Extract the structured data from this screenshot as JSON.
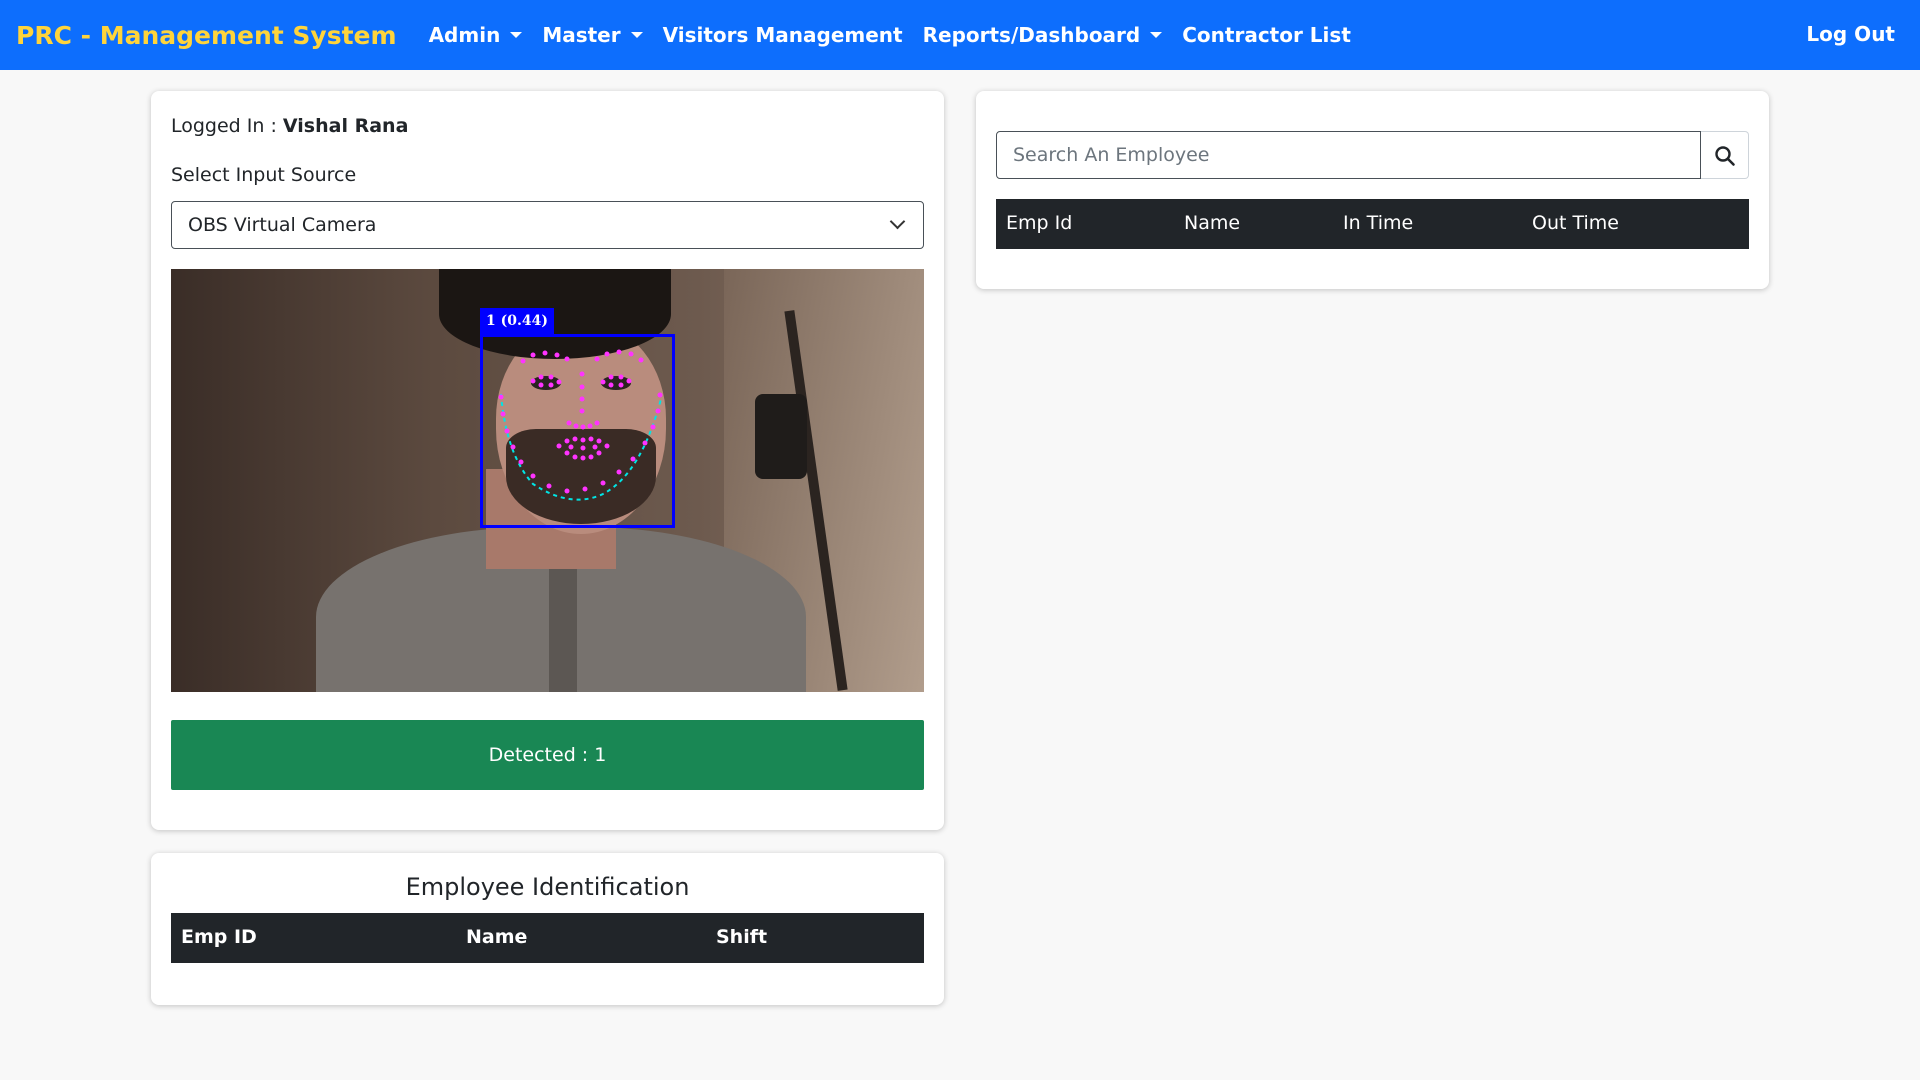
{
  "navbar": {
    "brand": "PRC - Management System",
    "items": [
      {
        "label": "Admin",
        "dropdown": true
      },
      {
        "label": "Master",
        "dropdown": true
      },
      {
        "label": "Visitors Management",
        "dropdown": false
      },
      {
        "label": "Reports/Dashboard",
        "dropdown": true
      },
      {
        "label": "Contractor List",
        "dropdown": false
      }
    ],
    "logout": "Log Out",
    "colors": {
      "background": "#0d6efd",
      "brand": "#ffd43b"
    }
  },
  "camera_panel": {
    "logged_in_label": "Logged In :",
    "logged_in_user": "Vishal Rana",
    "select_label": "Select Input Source",
    "selected_source": "OBS Virtual Camera",
    "detection_label": "1 (0.44)",
    "detected_text": "Detected : 1",
    "colors": {
      "detected_bg": "#198754",
      "bbox": "#0000ff",
      "landmark": "#ff33ff"
    }
  },
  "search_panel": {
    "placeholder": "Search An Employee",
    "search_icon": "search-icon",
    "columns": [
      "Emp Id",
      "Name",
      "In Time",
      "Out Time"
    ]
  },
  "identification_panel": {
    "title": "Employee Identification",
    "columns": [
      "Emp ID",
      "Name",
      "Shift"
    ]
  }
}
